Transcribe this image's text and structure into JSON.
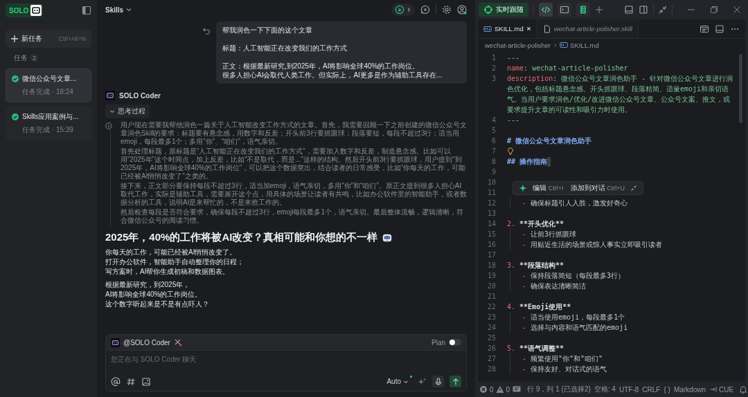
{
  "sidebar": {
    "logo": "SOLO",
    "new_task": {
      "label": "新任务",
      "shortcut": "Ctrl+Alt+N"
    },
    "section": {
      "label": "任务",
      "count": "2"
    },
    "tasks": [
      {
        "title": "微信公众号文章...",
        "status": "任务完成 · 18:24",
        "selected": true
      },
      {
        "title": "Skills应用案例与...",
        "status": "任务完成 · 15:39",
        "selected": false
      }
    ]
  },
  "chat": {
    "title": "Skills",
    "user_message": {
      "paragraphs": [
        [
          "帮我润色一下下面的这个文章"
        ],
        [
          "标题：人工智能正在改变我们的工作方式"
        ],
        [
          "正文：根据最新研究,到2025年，AI将影响全球40%的工作岗位。",
          "很多人担心AI会取代人类工作。但实际上，AI更多是作为辅助工具存在..."
        ]
      ]
    },
    "agent": {
      "name": "SOLO Coder",
      "thinking": {
        "label": "思考过程",
        "expanded": true,
        "paragraphs": [
          "用户现在需要我帮他润色一篇关于人工智能改变工作方式的文章。首先，我需要回顾一下之前创建的微信公众号文章润色Skill的要求：标题要有悬念感，用数字和反差；开头前3行要抓眼球；段落要短，每段不超过3行；适当用emoji，每段最多1个；多用“你”、“咱们”，语气亲切。",
          "首先处理标题，原标题是“人工智能正在改变我们的工作方式”，需要加入数字和反差，制造悬念感。比如可以用“2025年”这个时间点，加上反差，比如“不是取代，而是...”这样的结构。然后开头前3行要抓眼球，用户提到“到2025年，AI将影响全球40%的工作岗位”，可以把这个数据突出，结合读者的日常感受，比如“你每天的工作，可能已经被AI悄悄改变了”之类的。",
          "接下来，正文部分要保持每段不超过3行，适当加emoji，语气亲切，多用“你”和“咱们”。原正文提到很多人担心AI取代工作，实际是辅助工具，需要展开这个点，用具体的场景让读者有共鸣，比如办公软件里的智能助手，或者数据分析的工具，说明AI是来帮忙的，不是来抢工作的。",
          "然后检查每段是否符合要求，确保每段不超过3行，emoji每段最多1个，语气亲切。最后整体流畅，逻辑清晰，符合微信公众号的阅读习惯。"
        ]
      },
      "answer": {
        "heading": "2025年，40%的工作将被AI改变？真相可能和你想的不一样",
        "paragraphs": [
          [
            "你每天的工作，可能已经被AI悄悄改变了。",
            "打开办公软件，智能助手自动整理你的日程；",
            "写方案时，AI帮你生成初稿和数据图表。"
          ],
          [
            "根据最新研究，到2025年，",
            "AI将影响全球40%的工作岗位。",
            "这个数字听起来是不是有点吓人？"
          ]
        ]
      }
    },
    "composer": {
      "mention": "@SOLO Coder",
      "plan_label": "Plan",
      "plan_on": false,
      "placeholder": "您正在与 SOLO Coder 聊天",
      "model": "Auto"
    }
  },
  "editor": {
    "follow_button": "实时跟随",
    "tabs": [
      {
        "label": "SKILL.md",
        "selected": true,
        "italic": false
      },
      {
        "label": "wechat-article-polisher.skill",
        "selected": false,
        "italic": true
      }
    ],
    "breadcrumb": [
      "wechat-article-polisher",
      "SKILL.md"
    ],
    "lines": [
      {
        "n": "1",
        "parts": [
          {
            "kind": "punct",
            "text": "---"
          }
        ]
      },
      {
        "n": "2",
        "parts": [
          {
            "kind": "key",
            "text": "name"
          },
          {
            "kind": "punct",
            "text": ": "
          },
          {
            "kind": "value",
            "text": "wechat-article-polisher"
          }
        ]
      },
      {
        "n": "3",
        "parts": [
          {
            "kind": "key",
            "text": "description"
          },
          {
            "kind": "punct",
            "text": ": "
          },
          {
            "kind": "value",
            "text": "微信公众号文章润色助手 - 针对微信公众号文章进行润色优化，包括标题悬念感、开头抓眼球、段落精简、适量emoji和亲切语气。当用户要求润色/优化/改进微信公众号文章、公众号文案、推文，或要求提升文章的可读性和吸引力时使用。"
          }
        ]
      },
      {
        "n": "4",
        "parts": [
          {
            "kind": "punct",
            "text": "---"
          }
        ]
      },
      {
        "n": "5"
      },
      {
        "n": "6",
        "parts": [
          {
            "kind": "heading",
            "text": "# 微信公众号文章润色助手"
          }
        ]
      },
      {
        "n": "7",
        "parts": [
          {
            "kind": "bulb"
          }
        ]
      },
      {
        "n": "8",
        "parts": [
          {
            "kind": "heading",
            "text": "## 操作指南"
          }
        ],
        "cursor": true
      },
      {
        "n": "9"
      },
      {
        "n": "10"
      },
      {
        "n": "11"
      },
      {
        "n": "12",
        "indent": true,
        "parts": [
          {
            "kind": "dash",
            "text": "- "
          },
          {
            "kind": "text",
            "text": "确保标题引人入胜，激发好奇心"
          }
        ]
      },
      {
        "n": "13"
      },
      {
        "n": "14",
        "parts": [
          {
            "kind": "num",
            "text": "2. "
          },
          {
            "kind": "bold",
            "text": "**开头优化**"
          }
        ]
      },
      {
        "n": "15",
        "indent": true,
        "parts": [
          {
            "kind": "dash",
            "text": "- "
          },
          {
            "kind": "text",
            "text": "让前3行抓眼球"
          }
        ]
      },
      {
        "n": "16",
        "indent": true,
        "parts": [
          {
            "kind": "dash",
            "text": "- "
          },
          {
            "kind": "text",
            "text": "用贴近生活的场景或惊人事实立即吸引读者"
          }
        ]
      },
      {
        "n": "17"
      },
      {
        "n": "18",
        "parts": [
          {
            "kind": "num",
            "text": "3. "
          },
          {
            "kind": "bold",
            "text": "**段落结构**"
          }
        ]
      },
      {
        "n": "19",
        "indent": true,
        "parts": [
          {
            "kind": "dash",
            "text": "- "
          },
          {
            "kind": "text",
            "text": "保持段落简短（每段最多3行）"
          }
        ]
      },
      {
        "n": "20",
        "indent": true,
        "parts": [
          {
            "kind": "dash",
            "text": "- "
          },
          {
            "kind": "text",
            "text": "确保表达清晰简洁"
          }
        ]
      },
      {
        "n": "21"
      },
      {
        "n": "22",
        "parts": [
          {
            "kind": "num",
            "text": "4. "
          },
          {
            "kind": "bold",
            "text": "**Emoji使用**"
          }
        ]
      },
      {
        "n": "23",
        "indent": true,
        "parts": [
          {
            "kind": "dash",
            "text": "- "
          },
          {
            "kind": "text",
            "text": "适当使用emoji，每段最多1个"
          }
        ]
      },
      {
        "n": "24",
        "indent": true,
        "parts": [
          {
            "kind": "dash",
            "text": "- "
          },
          {
            "kind": "text",
            "text": "选择与内容和语气匹配的emoji"
          }
        ]
      },
      {
        "n": "25"
      },
      {
        "n": "26",
        "parts": [
          {
            "kind": "num",
            "text": "5. "
          },
          {
            "kind": "bold",
            "text": "**语气调整**"
          }
        ]
      },
      {
        "n": "27",
        "indent": true,
        "parts": [
          {
            "kind": "dash",
            "text": "- "
          },
          {
            "kind": "text",
            "text": "频繁使用\"你\"和\"咱们\""
          }
        ]
      },
      {
        "n": "28",
        "indent": true,
        "parts": [
          {
            "kind": "dash",
            "text": "- "
          },
          {
            "kind": "text",
            "text": "保持友好、对话式的语气"
          }
        ]
      }
    ],
    "popup": {
      "actions": [
        {
          "label": "编辑",
          "shortcut": "Ctrl+I"
        },
        {
          "label": "添加到对话",
          "shortcut": "Ctrl+U"
        }
      ]
    },
    "status_bar": {
      "errors": "0",
      "warnings": "0",
      "items": [
        "行 9，列 1 (已选择2)",
        "空格: 4",
        "UTF-8",
        "CRLF",
        "{ }",
        "Markdown"
      ],
      "cue": "CUE"
    }
  }
}
